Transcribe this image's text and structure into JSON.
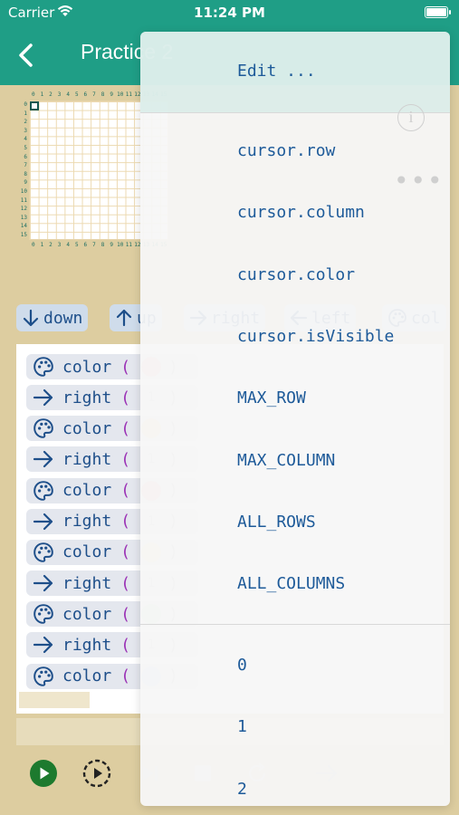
{
  "status_bar": {
    "carrier": "Carrier",
    "time": "11:24 PM"
  },
  "navbar": {
    "title": "Practice 2"
  },
  "grid": {
    "col_numbers": [
      "0",
      "1",
      "2",
      "3",
      "4",
      "5",
      "6",
      "7",
      "8",
      "9",
      "10",
      "11",
      "12",
      "13",
      "14",
      "15"
    ],
    "row_numbers": [
      "0",
      "1",
      "2",
      "3",
      "4",
      "5",
      "6",
      "7",
      "8",
      "9",
      "10",
      "11",
      "12",
      "13",
      "14",
      "15"
    ]
  },
  "chips": [
    {
      "label": "down",
      "icon": "arrow-down-icon"
    },
    {
      "label": "up",
      "icon": "arrow-up-icon"
    },
    {
      "label": "right",
      "icon": "arrow-right-icon"
    },
    {
      "label": "left",
      "icon": "arrow-left-icon"
    },
    {
      "label": "col",
      "icon": "palette-icon"
    }
  ],
  "program": [
    {
      "cmd": "color",
      "paren_open": "(",
      "paren_close": ")",
      "color": "#f4b9b9"
    },
    {
      "cmd": "right",
      "paren_open": "(",
      "paren_close": ")",
      "arg": "1"
    },
    {
      "cmd": "color",
      "paren_open": "(",
      "paren_close": ")",
      "color": "#f5dbae"
    },
    {
      "cmd": "right",
      "paren_open": "(",
      "paren_close": ")",
      "arg": "1"
    },
    {
      "cmd": "color",
      "paren_open": "(",
      "paren_close": ")",
      "color": "#f4b9b9"
    },
    {
      "cmd": "right",
      "paren_open": "(",
      "paren_close": ")",
      "arg": "1"
    },
    {
      "cmd": "color",
      "paren_open": "(",
      "paren_close": ")",
      "color": "#f6efb2"
    },
    {
      "cmd": "right",
      "paren_open": "(",
      "paren_close": ")",
      "arg": "1"
    },
    {
      "cmd": "color",
      "paren_open": "(",
      "paren_close": ")",
      "color": "#c4e6c0"
    },
    {
      "cmd": "right",
      "paren_open": "(",
      "paren_close": ")",
      "arg": "1"
    },
    {
      "cmd": "color",
      "paren_open": "(",
      "paren_close": ")",
      "color": "#c2daf2"
    }
  ],
  "menu": {
    "edit_label": "Edit ...",
    "items": [
      "cursor.row",
      "cursor.column",
      "cursor.color",
      "cursor.isVisible",
      "MAX_ROW",
      "MAX_COLUMN",
      "ALL_ROWS",
      "ALL_COLUMNS"
    ],
    "numbers": [
      "0",
      "1",
      "2"
    ],
    "info_label": "i"
  },
  "colors": {
    "accent": "#1f9e86",
    "background": "#ddcda0",
    "keyword": "#1e4f8a",
    "paren": "#9b33b6",
    "menu_text": "#1d5a99"
  }
}
